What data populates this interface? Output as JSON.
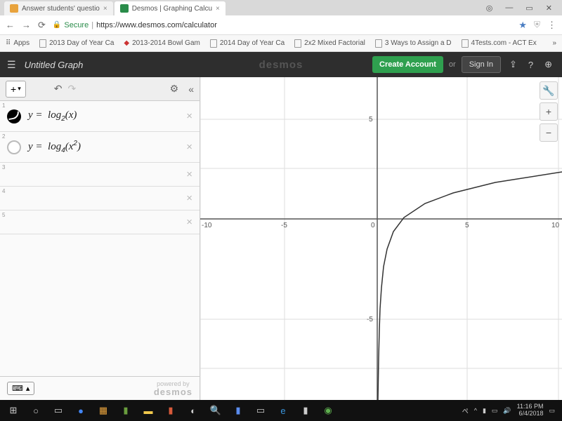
{
  "tabs": [
    {
      "title": "Answer students' questio",
      "active": false
    },
    {
      "title": "Desmos | Graphing Calcu",
      "active": true
    }
  ],
  "window": {
    "user": "◎",
    "min": "—",
    "max": "▭",
    "close": "✕"
  },
  "nav": {
    "back": "←",
    "fwd": "→",
    "reload": "⟳"
  },
  "url": {
    "secure": "Secure",
    "text": "https://www.desmos.com/calculator"
  },
  "bookmarks": [
    "Apps",
    "2013 Day of Year Ca",
    "2013-2014 Bowl Gam",
    "2014 Day of Year Ca",
    "2x2 Mixed Factorial",
    "3 Ways to Assign a D",
    "4Tests.com - ACT Ex"
  ],
  "header": {
    "title": "Untitled Graph",
    "logo": "desmos",
    "create": "Create Account",
    "or": "or",
    "signin": "Sign In"
  },
  "toolbar": {
    "add": "+",
    "undo": "↶",
    "redo": "↷",
    "gear": "⚙",
    "collapse": "«"
  },
  "expressions": [
    {
      "n": "1",
      "swatch": "sw1",
      "html": "y&nbsp;=&nbsp;&nbsp;log<sub>2</sub>(x)"
    },
    {
      "n": "2",
      "swatch": "sw2",
      "html": "y&nbsp;=&nbsp;&nbsp;log<sub>4</sub>(x<sup>2</sup>)"
    },
    {
      "n": "3",
      "empty": true
    },
    {
      "n": "4",
      "empty": true
    },
    {
      "n": "5",
      "empty": true
    }
  ],
  "footer": {
    "kbd": "⌨",
    "arrow": "▴",
    "powered": "powered by",
    "brand": "desmos"
  },
  "axes": {
    "xticks": [
      -10,
      -5,
      0,
      5,
      10
    ],
    "yticks": [
      5,
      -5
    ]
  },
  "chart_data": {
    "type": "line",
    "title": "",
    "xlabel": "",
    "ylabel": "",
    "xlim": [
      -10,
      10
    ],
    "ylim": [
      -8,
      8
    ],
    "series": [
      {
        "name": "y = log2(x)",
        "x": [
          0.1,
          0.25,
          0.5,
          1,
          2,
          4,
          6,
          8,
          10
        ],
        "y": [
          -3.32,
          -2.0,
          -1.0,
          0,
          1.0,
          2.0,
          2.58,
          3.0,
          3.32
        ]
      }
    ]
  },
  "clock": {
    "time": "11:16 PM",
    "date": "6/4/2018"
  }
}
